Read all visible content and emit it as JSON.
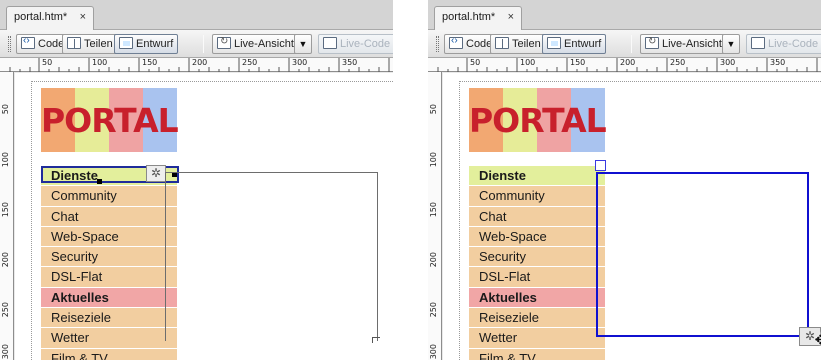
{
  "panels": [
    {
      "id": "left",
      "tab": {
        "title": "portal.htm*",
        "close": "×"
      },
      "toolbar": {
        "code_label": "Code",
        "split_label": "Teilen",
        "design_label": "Entwurf",
        "live_view_label": "Live-Ansicht",
        "live_code_label": "Live-Code"
      },
      "ruler": {
        "h": [
          "50",
          "100",
          "150",
          "200",
          "250",
          "300",
          "350"
        ],
        "v": [
          "50",
          "100",
          "150",
          "200",
          "250",
          "300"
        ]
      },
      "page": {
        "logo_text": "PORTAL",
        "menu": [
          "Dienste",
          "Community",
          "Chat",
          "Web-Space",
          "Security",
          "DSL-Flat",
          "Aktuelles",
          "Reiseziele",
          "Wetter",
          "Film & TV"
        ]
      }
    },
    {
      "id": "right",
      "tab": {
        "title": "portal.htm*",
        "close": "×"
      },
      "toolbar": {
        "code_label": "Code",
        "split_label": "Teilen",
        "design_label": "Entwurf",
        "live_view_label": "Live-Ansicht",
        "live_code_label": "Live-Code"
      },
      "ruler": {
        "h": [
          "50",
          "100",
          "150",
          "200",
          "250",
          "300",
          "350"
        ],
        "v": [
          "50",
          "100",
          "150",
          "200",
          "250",
          "300"
        ]
      },
      "page": {
        "logo_text": "PORTAL",
        "menu": [
          "Dienste",
          "Community",
          "Chat",
          "Web-Space",
          "Security",
          "DSL-Flat",
          "Aktuelles",
          "Reiseziele",
          "Wetter",
          "Film & TV"
        ]
      }
    }
  ],
  "colors": {
    "logo_bands": [
      "#f2a872",
      "#e6ec98",
      "#efa3a3",
      "#a9c3ef"
    ],
    "logo_text": "#c8202c",
    "menu_default": "#f2cea0",
    "menu_green": "#e3ef9c",
    "menu_pink": "#f1a6a6",
    "selection_left": "#1f2c9b",
    "ap_div_right": "#1010d0"
  },
  "icons": {
    "code": "code-view-icon",
    "split": "split-view-icon",
    "design": "design-view-icon",
    "live": "live-view-icon",
    "live_code": "live-code-icon",
    "gear": "gear-icon",
    "move": "move-cursor-icon"
  }
}
